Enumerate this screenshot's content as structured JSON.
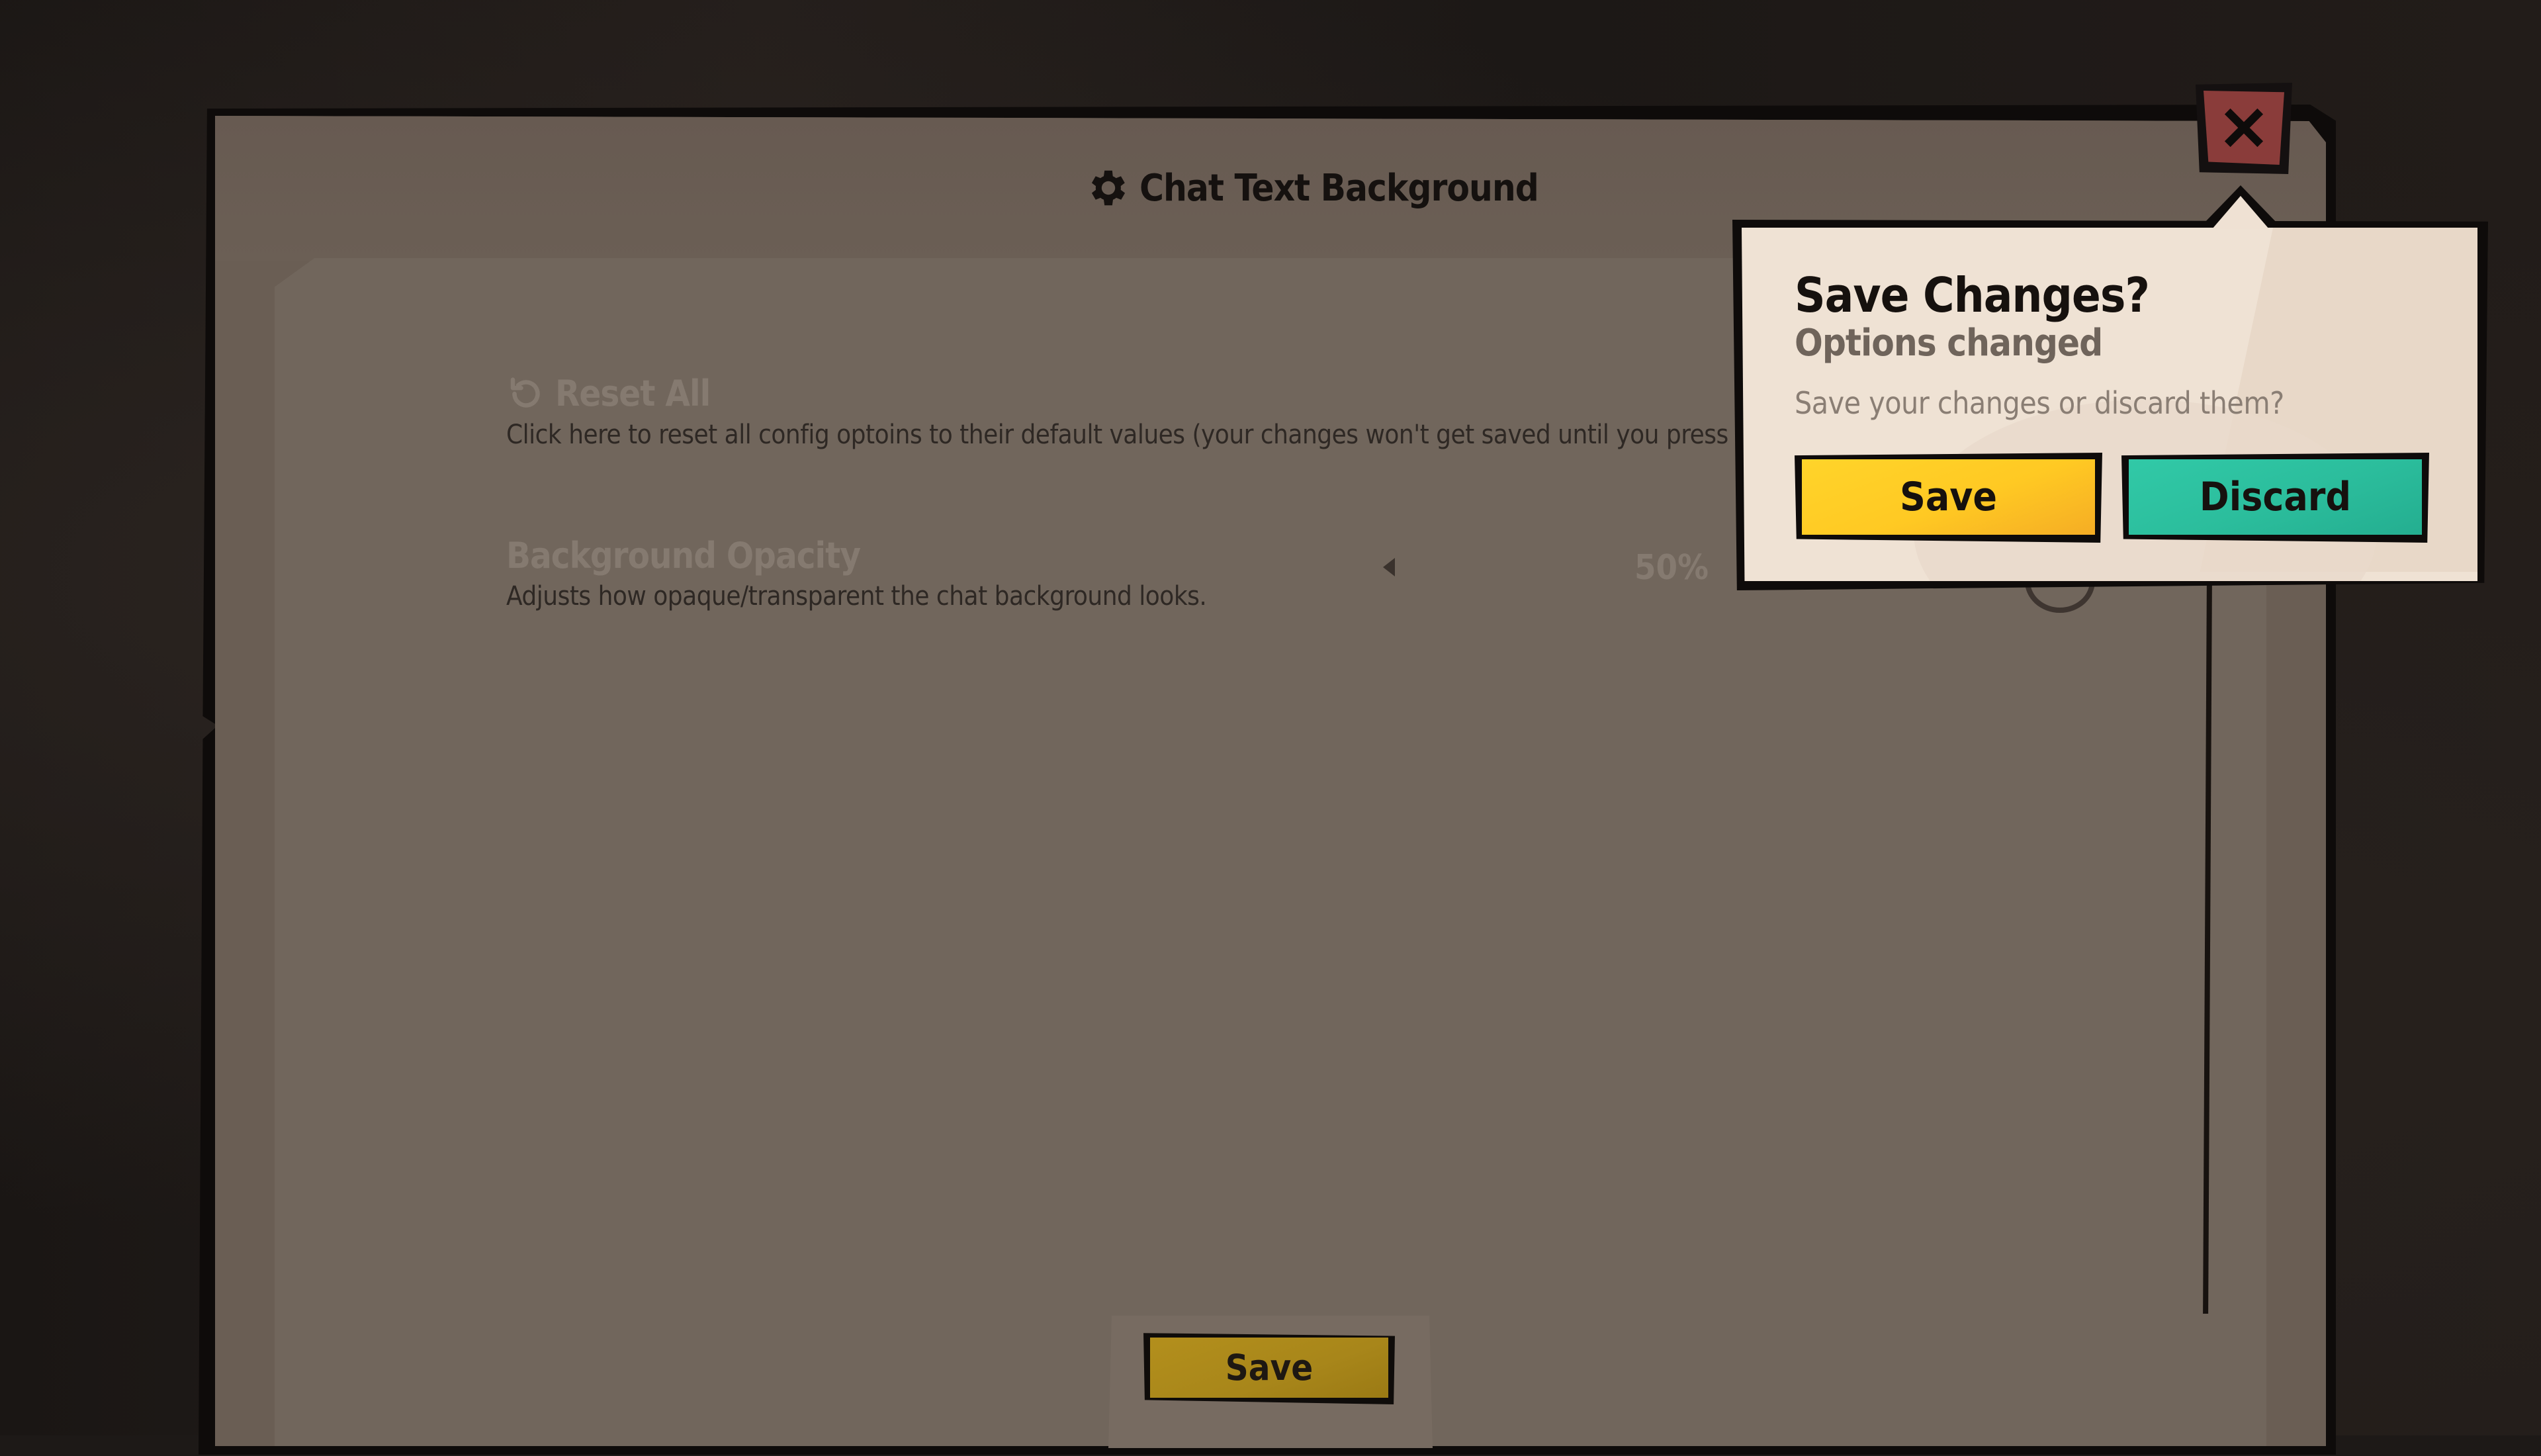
{
  "dialog": {
    "title": "Chat Text Background"
  },
  "settings": {
    "reset": {
      "label": "Reset All",
      "description": "Click here to reset all config optoins to their default values (your changes won't get saved until you press"
    },
    "opacity": {
      "label": "Background Opacity",
      "description": "Adjusts how opaque/transparent the chat background looks.",
      "value": "50%"
    }
  },
  "footer": {
    "save_label": "Save"
  },
  "popup": {
    "title": "Save Changes?",
    "subtitle": "Options changed",
    "message": "Save your changes or discard them?",
    "save_label": "Save",
    "discard_label": "Discard"
  },
  "colors": {
    "save_yellow": "#ffc923",
    "discard_teal": "#2bbd9c",
    "close_red": "#8a3c3a",
    "panel": "#6a5e54"
  },
  "icons": {
    "title": "gear-icon",
    "reset": "reset-icon",
    "close": "close-icon"
  }
}
